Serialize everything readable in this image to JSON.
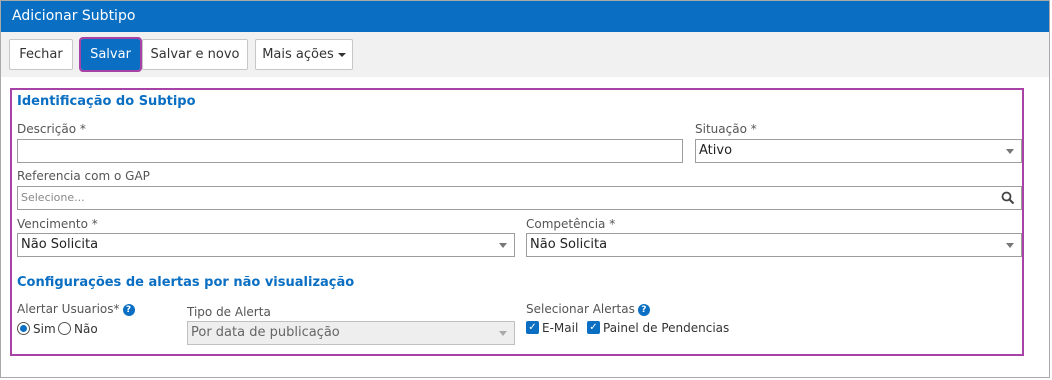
{
  "window": {
    "title": "Adicionar Subtipo"
  },
  "toolbar": {
    "close_label": "Fechar",
    "save_label": "Salvar",
    "save_new_label": "Salvar e novo",
    "more_actions_label": "Mais ações"
  },
  "identification": {
    "title": "Identificação do Subtipo",
    "description_label": "Descrição *",
    "description_value": "",
    "situation_label": "Situação *",
    "situation_value": "Ativo",
    "gap_label": "Referencia com o GAP",
    "gap_placeholder": "Selecione...",
    "due_label": "Vencimento *",
    "due_value": "Não Solicita",
    "competence_label": "Competência *",
    "competence_value": "Não Solicita"
  },
  "alerts": {
    "title": "Configurações de alertas por não visualização",
    "alert_users_label": "Alertar Usuarios*",
    "yes_label": "Sim",
    "no_label": "Não",
    "alert_users_selected": "Sim",
    "alert_type_label": "Tipo de Alerta",
    "alert_type_value": "Por data de publicação",
    "select_alerts_label": "Selecionar Alertas",
    "email_label": "E-Mail",
    "email_checked": true,
    "pending_panel_label": "Painel de Pendencias",
    "pending_panel_checked": true
  },
  "colors": {
    "accent": "#0a6fc2",
    "highlight": "#a742a7"
  }
}
